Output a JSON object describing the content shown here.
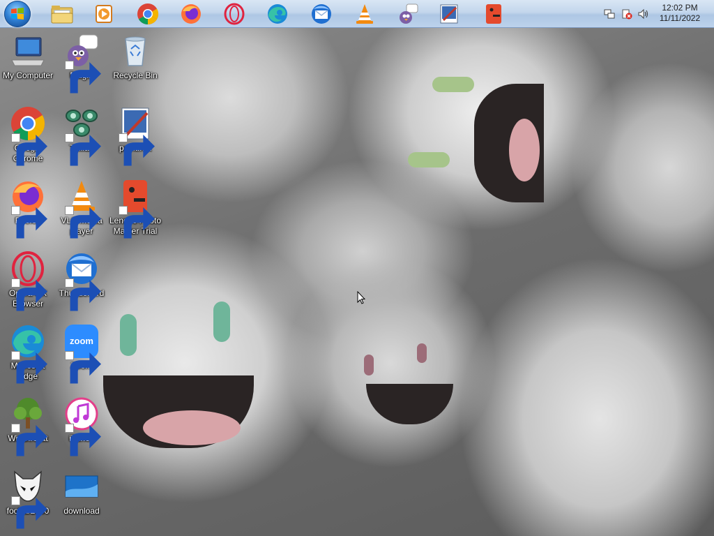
{
  "taskbar": {
    "start_button": "start-button",
    "pinned": [
      {
        "name": "windows-explorer",
        "icon": "folder-icon"
      },
      {
        "name": "media-player",
        "icon": "media-player-icon"
      },
      {
        "name": "google-chrome",
        "icon": "chrome-icon"
      },
      {
        "name": "firefox",
        "icon": "firefox-icon"
      },
      {
        "name": "opera",
        "icon": "opera-icon"
      },
      {
        "name": "microsoft-edge",
        "icon": "edge-icon"
      },
      {
        "name": "thunderbird",
        "icon": "thunderbird-icon"
      },
      {
        "name": "vlc",
        "icon": "vlc-icon"
      },
      {
        "name": "pidgin",
        "icon": "pidgin-icon"
      },
      {
        "name": "paint-net",
        "icon": "paintnet-icon"
      },
      {
        "name": "lenovo-photo-master",
        "icon": "lenovo-photo-icon"
      }
    ],
    "tray": {
      "icons": [
        "network-icon",
        "action-center-alert-icon",
        "volume-icon"
      ],
      "time": "12:02 PM",
      "date": "11/11/2022"
    }
  },
  "desktop": {
    "icons": [
      {
        "label": "My Computer"
      },
      {
        "label": "Pidgin"
      },
      {
        "label": "Recycle Bin"
      },
      {
        "label": "Google Chrome"
      },
      {
        "label": "Trillian"
      },
      {
        "label": "paint.net"
      },
      {
        "label": "Firefox"
      },
      {
        "label": "VLC media player"
      },
      {
        "label": "Lenovo Photo Master Trial"
      },
      {
        "label": "Opera GX Browser"
      },
      {
        "label": "Thunderbird"
      },
      {
        "label": "Microsoft Edge"
      },
      {
        "label": "Zoom"
      },
      {
        "label": "WinDirStat"
      },
      {
        "label": "iTunes"
      },
      {
        "label": "foobar2000"
      },
      {
        "label": "download"
      }
    ],
    "zoom_icon_text": "zoom"
  },
  "colors": {
    "taskbar": "#c3d6ec",
    "chrome_red": "#db4437",
    "chrome_green": "#0f9d58",
    "chrome_yellow": "#f4b400",
    "chrome_blue": "#4285f4",
    "opera_red": "#e0233f",
    "zoom_blue": "#2d8cff",
    "vlc_orange": "#f28a10"
  }
}
